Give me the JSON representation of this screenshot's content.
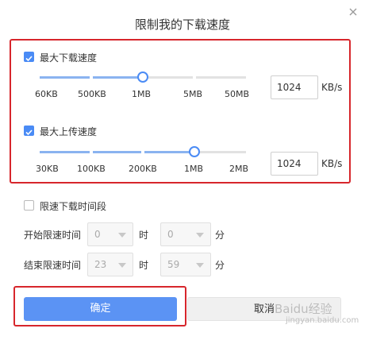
{
  "dialog": {
    "title": "限制我的下载速度"
  },
  "download": {
    "label": "最大下载速度",
    "checked": true,
    "ticks": [
      "60KB",
      "500KB",
      "1MB",
      "5MB",
      "50MB"
    ],
    "level": 0.5,
    "value": "1024",
    "unit": "KB/s"
  },
  "upload": {
    "label": "最大上传速度",
    "checked": true,
    "ticks": [
      "30KB",
      "100KB",
      "200KB",
      "1MB",
      "2MB"
    ],
    "level": 0.75,
    "value": "1024",
    "unit": "KB/s"
  },
  "schedule": {
    "label": "限速下载时间段",
    "checked": false,
    "start_label": "开始限速时间",
    "start_hour": "0",
    "start_minute": "0",
    "end_label": "结束限速时间",
    "end_hour": "23",
    "end_minute": "59",
    "hour_unit": "时",
    "minute_unit": "分"
  },
  "buttons": {
    "ok": "确定",
    "cancel": "取消"
  },
  "watermark": {
    "logo": "Baidu经验",
    "url": "jingyan.baidu.com"
  },
  "colors": {
    "accent": "#4a8bf5",
    "highlight_box": "#d7262c"
  }
}
